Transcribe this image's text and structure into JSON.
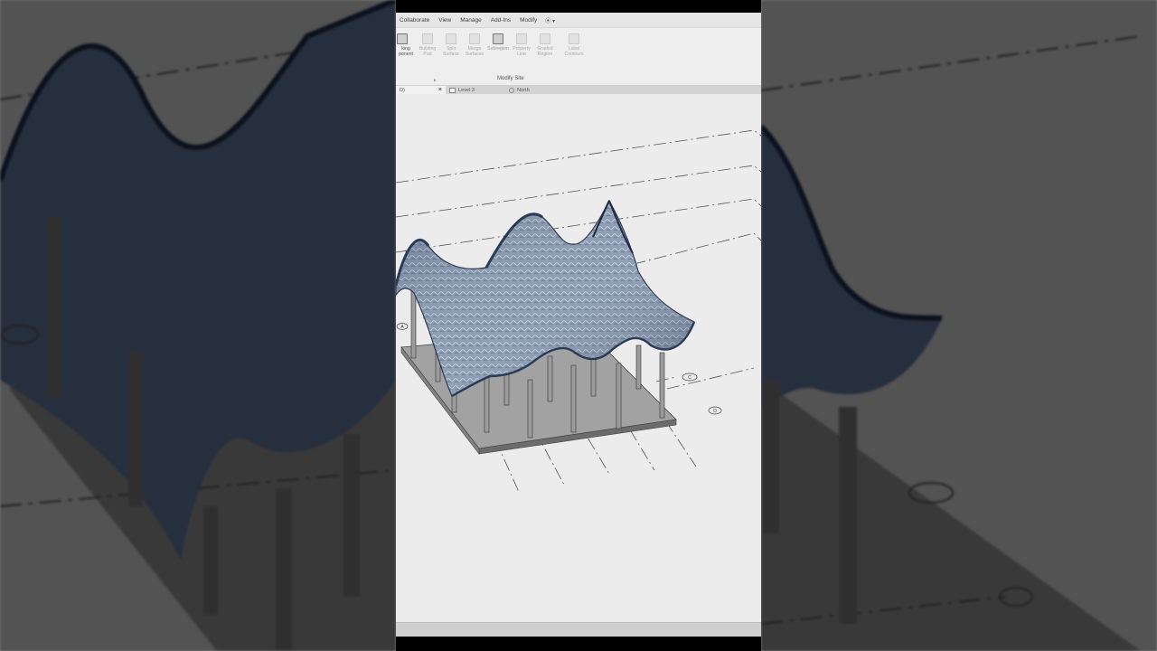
{
  "ribbon": {
    "menu": [
      "Collaborate",
      "View",
      "Manage",
      "Add-Ins",
      "Modify"
    ],
    "menu_extra": "⦿ ▾",
    "tools": [
      {
        "label": "king\nponent",
        "icon": "component-icon",
        "active": true
      },
      {
        "label": "Building\nPad",
        "icon": "building-pad-icon",
        "active": false
      },
      {
        "label": "Split\nSurface",
        "icon": "split-surface-icon",
        "active": false
      },
      {
        "label": "Merge\nSurfaces",
        "icon": "merge-surfaces-icon",
        "active": false
      },
      {
        "label": "Subregion",
        "icon": "subregion-icon",
        "active": false
      },
      {
        "label": "Property\nLine",
        "icon": "property-line-icon",
        "active": false
      },
      {
        "label": "Graded\nRegion",
        "icon": "graded-region-icon",
        "active": false
      },
      {
        "label": "Label\nContours",
        "icon": "label-contours-icon",
        "active": false
      }
    ],
    "panel_label": "Modify Site"
  },
  "tabs": {
    "active": "D)",
    "level": "Level 3",
    "north": "North"
  },
  "grid_bubbles": [
    "A",
    "C",
    "D"
  ],
  "colors": {
    "viewport_bg": "#ececec",
    "canopy": "#7b8ea8",
    "canopy_edge": "#2b3a55",
    "slab": "#8c8c8c",
    "column": "#9a9a9a"
  }
}
